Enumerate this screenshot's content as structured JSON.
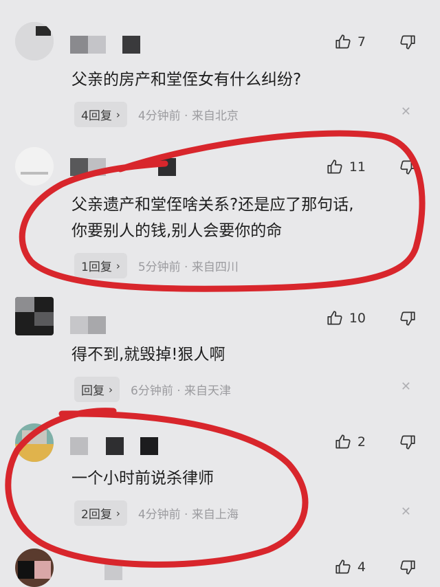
{
  "comments": [
    {
      "text": "父亲的房产和堂侄女有什么纠纷?",
      "likes": "7",
      "reply_label": "4回复",
      "time": "4分钟前 · 来自北京"
    },
    {
      "text_line1": "父亲遗产和堂侄啥关系?还是应了那句话,",
      "text_line2": "你要别人的钱,别人会要你的命",
      "likes": "11",
      "reply_label": "1回复",
      "time": "5分钟前 · 来自四川"
    },
    {
      "text": "得不到,就毁掉!狠人啊",
      "likes": "10",
      "reply_label": "回复",
      "time": "6分钟前 · 来自天津"
    },
    {
      "text": "一个小时前说杀律师",
      "likes": "2",
      "reply_label": "2回复",
      "time": "4分钟前 · 来自上海"
    },
    {
      "likes": "4"
    }
  ],
  "icons": {
    "like": "thumbs-up-icon",
    "dislike": "thumbs-down-icon",
    "close": "close-icon",
    "chevron": "chevron-right-icon"
  },
  "colors": {
    "background": "#e8e8ea",
    "annotation": "#d8262c"
  }
}
